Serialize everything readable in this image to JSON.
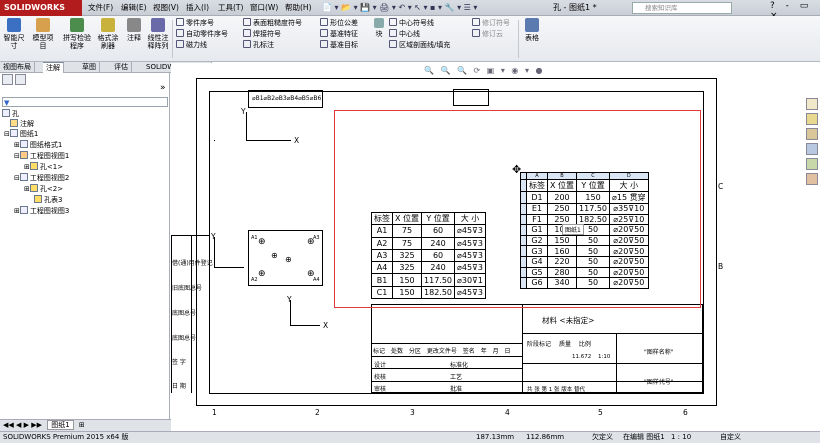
{
  "app": {
    "logo_text": "SOLIDWORKS",
    "doc_title": "孔 - 图纸1 *",
    "search_placeholder": "搜索知识库",
    "window_controls": "? - ▭ ×"
  },
  "menu": [
    "文件(F)",
    "编辑(E)",
    "视图(V)",
    "插入(I)",
    "工具(T)",
    "窗口(W)",
    "帮助(H)"
  ],
  "ribbon": {
    "big": [
      {
        "label": "智能尺寸"
      },
      {
        "label": "模型项目"
      },
      {
        "label": "拼写检验程序"
      },
      {
        "label": "格式涂刷器"
      },
      {
        "label": "注释"
      },
      {
        "label": "线性注释阵列"
      }
    ],
    "small_col1": [
      "零件序号",
      "自动零件序号",
      "磁力线"
    ],
    "small_col2": [
      "表面粗糙度符号",
      "焊接符号",
      "孔标注"
    ],
    "small_col3": [
      "形位公差",
      "基准特征",
      "基准目标"
    ],
    "small_col4": [
      "中心符号线",
      "中心线",
      "区域剖面线/填充"
    ],
    "small_col5": [
      "修订符号",
      "修订云"
    ],
    "block": "块",
    "table": "表格"
  },
  "tabs": [
    "视图布局",
    "注解",
    "草图",
    "评估",
    "SOLIDWORKS 插件"
  ],
  "active_tab": "注解",
  "tree": [
    "孔",
    "注解",
    "图纸1",
    "图纸格式1",
    "工程图视图1",
    "孔<1>",
    "工程图视图2",
    "孔<2>",
    "孔表3",
    "工程图视图3"
  ],
  "hole_table": {
    "col_letters": [
      "A",
      "B",
      "C",
      "D"
    ],
    "headers": [
      "标签",
      "X 位置",
      "Y 位置",
      "大 小"
    ],
    "rows": [
      [
        "D1",
        "200",
        "150",
        "⌀15 贯穿"
      ],
      [
        "E1",
        "250",
        "117.50",
        "⌀35⊽10"
      ],
      [
        "F1",
        "250",
        "182.50",
        "⌀25⊽10"
      ],
      [
        "G1",
        "100",
        "50",
        "⌀20⊽50"
      ],
      [
        "G2",
        "150",
        "50",
        "⌀20⊽50"
      ],
      [
        "G3",
        "160",
        "50",
        "⌀20⊽50"
      ],
      [
        "G4",
        "220",
        "50",
        "⌀20⊽50"
      ],
      [
        "G5",
        "280",
        "50",
        "⌀20⊽50"
      ],
      [
        "G6",
        "340",
        "50",
        "⌀20⊽50"
      ]
    ],
    "tooltip": "图纸1"
  },
  "hole_table_left": {
    "headers": [
      "标签",
      "X 位置",
      "Y 位置",
      "大 小"
    ],
    "rows": [
      [
        "A1",
        "75",
        "60",
        "⌀45⊽3"
      ],
      [
        "A2",
        "75",
        "240",
        "⌀45⊽3"
      ],
      [
        "A3",
        "325",
        "60",
        "⌀45⊽3"
      ],
      [
        "A4",
        "325",
        "240",
        "⌀45⊽3"
      ],
      [
        "B1",
        "150",
        "117.50",
        "⌀30⊽1"
      ],
      [
        "C1",
        "150",
        "182.50",
        "⌀45⊽3"
      ]
    ]
  },
  "view1": {
    "labels": [
      "⌀B1",
      "⌀B2",
      "⌀B3",
      "⌀B4",
      "⌀B5",
      "⌀B6"
    ]
  },
  "view2": {
    "holes": [
      "A1",
      "A2",
      "A3",
      "A4",
      "B1",
      "C1"
    ]
  },
  "axis": {
    "x": "X",
    "y": "Y"
  },
  "left_labels": [
    "借(通)用件登记",
    "旧底图总号",
    "底图总号",
    "签 字",
    "日 期"
  ],
  "title_block": {
    "material": "材料 <未指定>",
    "row1": [
      "标记",
      "处数",
      "分区",
      "更改文件号",
      "签名",
      "年 月 日"
    ],
    "row2": [
      "阶段标记",
      "质量",
      "比例"
    ],
    "scale": "1:10",
    "mass": "11.672",
    "drawing_name": "\"图样名称\"",
    "drawing_code": "\"图样代号\"",
    "roles": [
      "设计",
      "校核",
      "审核",
      "工艺",
      "标准化",
      "批准"
    ],
    "bottom": "共 张  第 1 张  版本        替代"
  },
  "border_numbers": [
    "1",
    "2",
    "3",
    "4",
    "5",
    "6"
  ],
  "border_letters": [
    "A",
    "B",
    "C",
    "D"
  ],
  "sheet_tab": "图纸1",
  "status": {
    "app": "SOLIDWORKS Premium 2015 x64 版",
    "x": "187.13mm",
    "y": "112.86mm",
    "state": "欠定义",
    "editing": "在编辑 图纸1",
    "scale": "1 : 10",
    "custom": "自定义"
  }
}
